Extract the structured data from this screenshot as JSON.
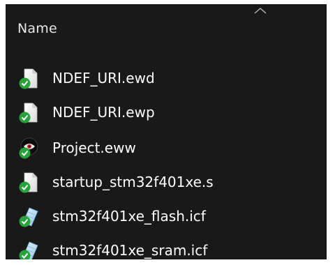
{
  "header": {
    "name_label": "Name",
    "sort_icon": "chevron-up-icon"
  },
  "files": [
    {
      "name": "NDEF_URI.ewd",
      "icon": "document-icon",
      "status_icon": "sync-check-icon"
    },
    {
      "name": "NDEF_URI.ewp",
      "icon": "document-icon",
      "status_icon": "sync-check-icon"
    },
    {
      "name": "Project.eww",
      "icon": "iar-workspace-icon",
      "status_icon": "sync-check-icon"
    },
    {
      "name": "startup_stm32f401xe.s",
      "icon": "document-icon",
      "status_icon": "sync-check-icon"
    },
    {
      "name": "stm32f401xe_flash.icf",
      "icon": "notepad-icon",
      "status_icon": "sync-check-icon"
    },
    {
      "name": "stm32f401xe_sram.icf",
      "icon": "notepad-icon",
      "status_icon": "sync-check-icon"
    }
  ],
  "colors": {
    "background": "#191919",
    "sync_green": "#27a33b",
    "text": "#ffffff"
  }
}
